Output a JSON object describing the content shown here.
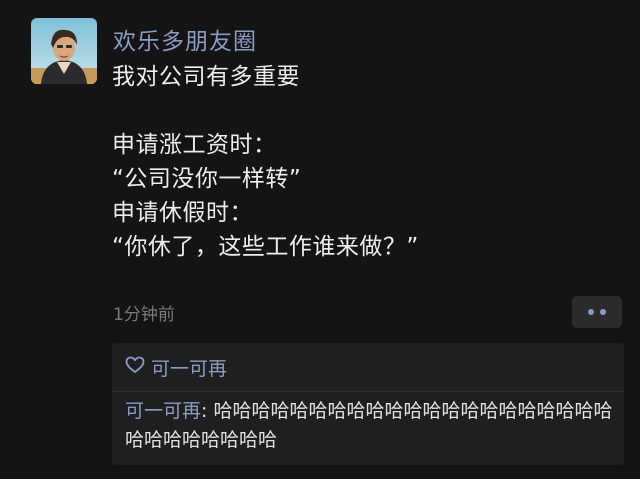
{
  "post": {
    "author": "欢乐多朋友圈",
    "lines": [
      "我对公司有多重要",
      "",
      "申请涨工资时：",
      "“公司没你一样转”",
      "申请休假时：",
      "“你休了，这些工作谁来做？”"
    ],
    "time": "1分钟前"
  },
  "likes": {
    "name": "可一可再"
  },
  "comment": {
    "author": "可一可再",
    "separator": ": ",
    "text": "哈哈哈哈哈哈哈哈哈哈哈哈哈哈哈哈哈哈哈哈哈哈哈哈哈哈哈哈哈"
  },
  "icons": {
    "like": "heart-outline-icon",
    "more": "two-dots-icon"
  },
  "colors": {
    "background": "#141414",
    "link_blue": "#8a9bc4",
    "panel": "#1f1f1f"
  }
}
